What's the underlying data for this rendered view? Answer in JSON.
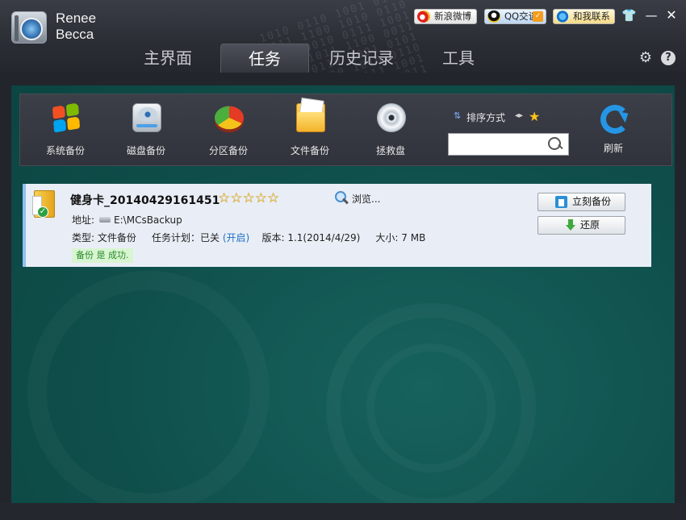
{
  "app": {
    "brand_line1": "Renee",
    "brand_line2": "Becca"
  },
  "topbar": {
    "weibo_label": "新浪微博",
    "qq_label": "QQ交谈",
    "contact_label": "和我联系",
    "minimize_glyph": "—",
    "close_glyph": "✕",
    "skin_glyph": "👕"
  },
  "tabs": [
    {
      "label": "主界面"
    },
    {
      "label": "任务",
      "active": true
    },
    {
      "label": "历史记录"
    },
    {
      "label": "工具"
    }
  ],
  "toolbar": {
    "items": [
      {
        "label": "系统备份",
        "icon": "windows-icon"
      },
      {
        "label": "磁盘备份",
        "icon": "hard-disk-icon"
      },
      {
        "label": "分区备份",
        "icon": "pie-partition-icon"
      },
      {
        "label": "文件备份",
        "icon": "folder-icon"
      },
      {
        "label": "拯救盘",
        "icon": "cd-icon"
      }
    ],
    "sort_label": "排序方式",
    "search_value": "",
    "refresh_label": "刷新"
  },
  "task": {
    "title": "健身卡_20140429161451",
    "rating": 5,
    "stars_text": "☆☆☆☆☆",
    "browse_label": "浏览...",
    "address_label": "地址:",
    "address_value": "E:\\MCsBackup",
    "type_label": "类型:",
    "type_value": "文件备份",
    "plan_label": "任务计划：",
    "plan_value": "已关",
    "plan_link": "(开启)",
    "version_label": "版本:",
    "version_value": "1.1(2014/4/29)",
    "size_label": "大小:",
    "size_value": "7 MB",
    "status_text": "备份 是 成功.",
    "backup_now_label": "立刻备份",
    "restore_label": "还原"
  },
  "colors": {
    "panel_teal": "#0f4f4b",
    "card_bg": "#e9eef6",
    "accent_blue": "#1d6fc4",
    "success_green": "#2a8a2a",
    "star_gold": "#f4b81b"
  }
}
